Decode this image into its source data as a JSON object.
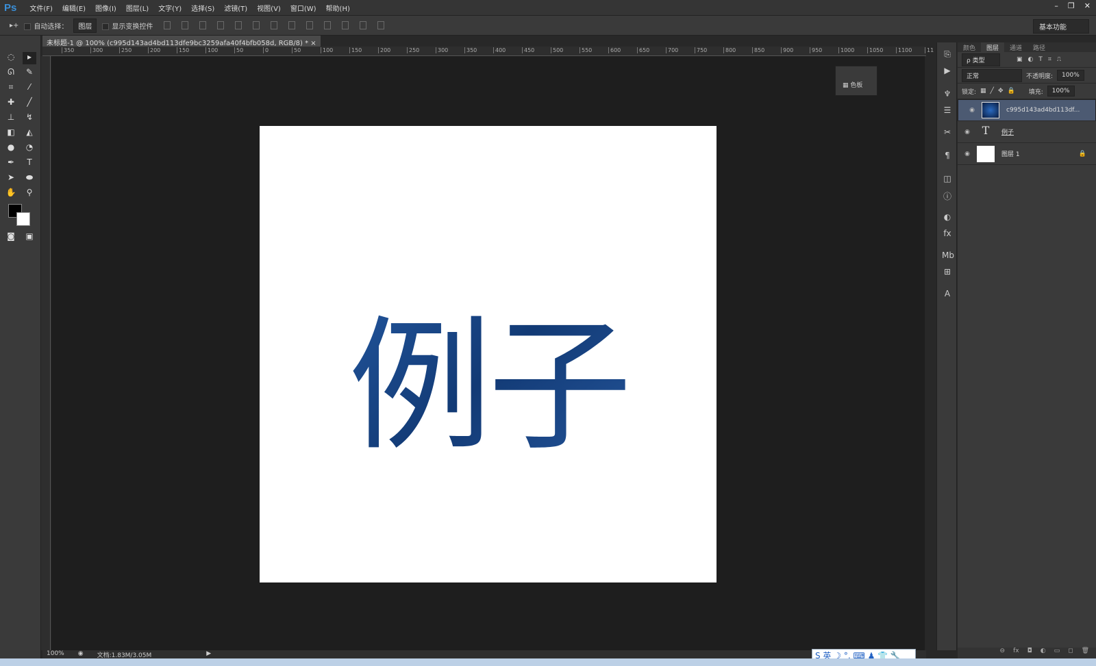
{
  "app": {
    "logo": "Ps",
    "menus": [
      "文件(F)",
      "编辑(E)",
      "图像(I)",
      "图层(L)",
      "文字(Y)",
      "选择(S)",
      "滤镜(T)",
      "视图(V)",
      "窗口(W)",
      "帮助(H)"
    ],
    "window_controls": [
      "–",
      "❐",
      "✕"
    ]
  },
  "options": {
    "tool": "▸+",
    "auto_select": "自动选择：",
    "auto_select_target": "图层",
    "show_transform": "显示变换控件",
    "workspace": "基本功能"
  },
  "document": {
    "tab_title": "未标题-1 @ 100% (c995d143ad4bd113dfe9bc3259afa40f4bfb058d, RGB/8) *",
    "close": "×",
    "text": "例子",
    "ruler_ticks": [
      "350",
      "300",
      "250",
      "200",
      "150",
      "100",
      "50",
      "0",
      "50",
      "100",
      "150",
      "200",
      "250",
      "300",
      "350",
      "400",
      "450",
      "500",
      "550",
      "600",
      "650",
      "700",
      "750",
      "800",
      "850",
      "900",
      "950",
      "1000",
      "1050",
      "1100",
      "11"
    ]
  },
  "swatches_panel": {
    "label": "色板"
  },
  "status": {
    "zoom": "100%",
    "doc_size": "文档:1.83M/3.05M"
  },
  "ime": {
    "label": "S 英 ☽ °, ⌨ ♟ 👕 🔧"
  },
  "layers_panel": {
    "tabs": [
      "颜色",
      "图层",
      "通道",
      "路径"
    ],
    "filter": "ρ 类型",
    "blend_mode": "正常",
    "opacity_label": "不透明度:",
    "opacity": "100%",
    "lock_label": "锁定:",
    "fill_label": "填充:",
    "fill": "100%",
    "layers": [
      {
        "name": "c995d143ad4bd113df...",
        "type": "smart",
        "selected": true
      },
      {
        "name": "例子",
        "type": "text"
      },
      {
        "name": "图层 1",
        "type": "pixel",
        "locked": true
      }
    ],
    "bottom_icons": [
      "⊖",
      "fx",
      "◘",
      "◐",
      "▭",
      "◻",
      "🗑"
    ]
  },
  "colors": {
    "text_blue": "#1d4a8a",
    "selection": "#4c5a72"
  }
}
